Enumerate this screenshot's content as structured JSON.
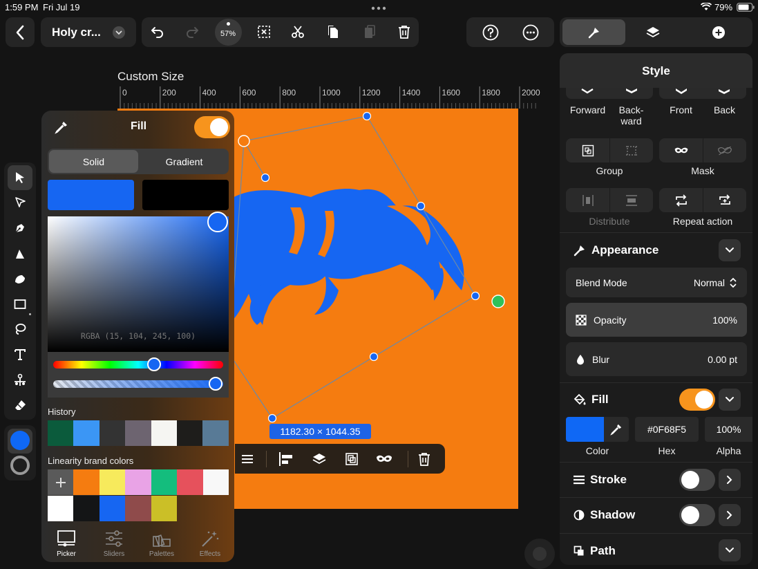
{
  "status": {
    "time": "1:59 PM",
    "date": "Fri Jul 19",
    "battery": "79%"
  },
  "toolbar": {
    "doc_title": "Holy cr...",
    "zoom": "57%"
  },
  "canvas": {
    "label": "Custom Size",
    "ruler": [
      "0",
      "200",
      "400",
      "600",
      "800",
      "1000",
      "1200",
      "1400",
      "1600",
      "1800",
      "2000"
    ],
    "size_tag": "1182.30 × 1044.35"
  },
  "fill_popup": {
    "title": "Fill",
    "tabs": [
      "Solid",
      "Gradient"
    ],
    "rgba_label": "RGBA (15, 104, 245, 100)",
    "history_title": "History",
    "history": [
      "#0b5b3c",
      "#3b96f5",
      "#333333",
      "#6d6470",
      "#f5f5f2",
      "#1e1d1b",
      "#587a96"
    ],
    "brand_title": "Linearity brand colors",
    "brand_row1": [
      "#f57c10",
      "#f7ea5c",
      "#e9a3e6",
      "#14bd7d",
      "#e6515c",
      "#f8f8f8"
    ],
    "brand_row2": [
      "#ffffff",
      "#141516",
      "#1666f2",
      "#8f4b4b",
      "#cbbf27"
    ],
    "bottom_tabs": [
      "Picker",
      "Sliders",
      "Palettes",
      "Effects"
    ]
  },
  "right_tabs": [
    "style",
    "layers",
    "add"
  ],
  "style_panel": {
    "title": "Style",
    "arrange": [
      "Forward",
      "Back-\nward",
      "Front",
      "Back"
    ],
    "group_label": "Group",
    "mask_label": "Mask",
    "distribute_label": "Distribute",
    "repeat_label": "Repeat action",
    "appearance": {
      "title": "Appearance",
      "blend_label": "Blend Mode",
      "blend_value": "Normal",
      "opacity_label": "Opacity",
      "opacity_value": "100%",
      "blur_label": "Blur",
      "blur_value": "0.00 pt"
    },
    "fill": {
      "title": "Fill",
      "color": "#0F68F5",
      "hex": "#0F68F5",
      "alpha": "100%",
      "color_label": "Color",
      "hex_label": "Hex",
      "alpha_label": "Alpha"
    },
    "stroke_title": "Stroke",
    "shadow_title": "Shadow",
    "path_title": "Path"
  }
}
